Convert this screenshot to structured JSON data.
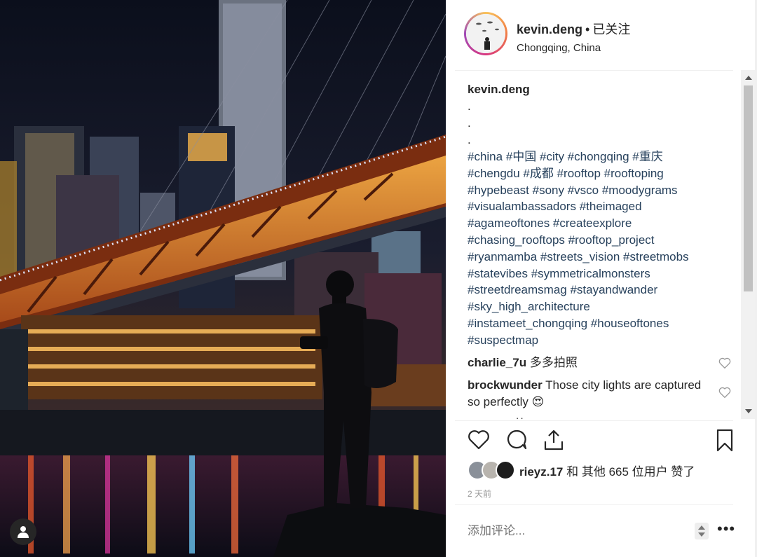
{
  "post": {
    "username": "kevin.deng",
    "separator": "•",
    "follow_status": "已关注",
    "location": "Chongqing, China"
  },
  "caption": {
    "username": "kevin.deng",
    "lines": [
      ".",
      ".",
      "."
    ],
    "hashtag_lines": [
      "#china #中国 #city #chongqing #重庆",
      "#chengdu #成都 #rooftop #rooftoping",
      "#hypebeast #sony #vsco #moodygrams",
      "#visualambassadors #theimaged",
      "#agameoftones #createexplore",
      "#chasing_rooftops #rooftop_project",
      "#ryanmamba #streets_vision #streetmobs",
      "#statevibes #symmetricalmonsters",
      "#streetdreamsmag #stayandwander",
      "#sky_high_architecture",
      "#instameet_chongqing #houseoftones",
      "#suspectmap"
    ]
  },
  "comments": [
    {
      "user": "charlie_7u",
      "text": "多多拍照"
    },
    {
      "user": "brockwunder",
      "text": "Those city lights are captured so perfectly 😍"
    },
    {
      "user": "jethoon",
      "text": "帅"
    }
  ],
  "likes": {
    "user": "rieyz.17",
    "text": "和 其他 665 位用户 赞了"
  },
  "time": "2 天前",
  "comment_input": {
    "placeholder": "添加评论..."
  },
  "more_label": "•••",
  "icons": [
    "heart-icon",
    "comment-icon",
    "share-icon",
    "bookmark-icon",
    "user-tag-icon"
  ]
}
